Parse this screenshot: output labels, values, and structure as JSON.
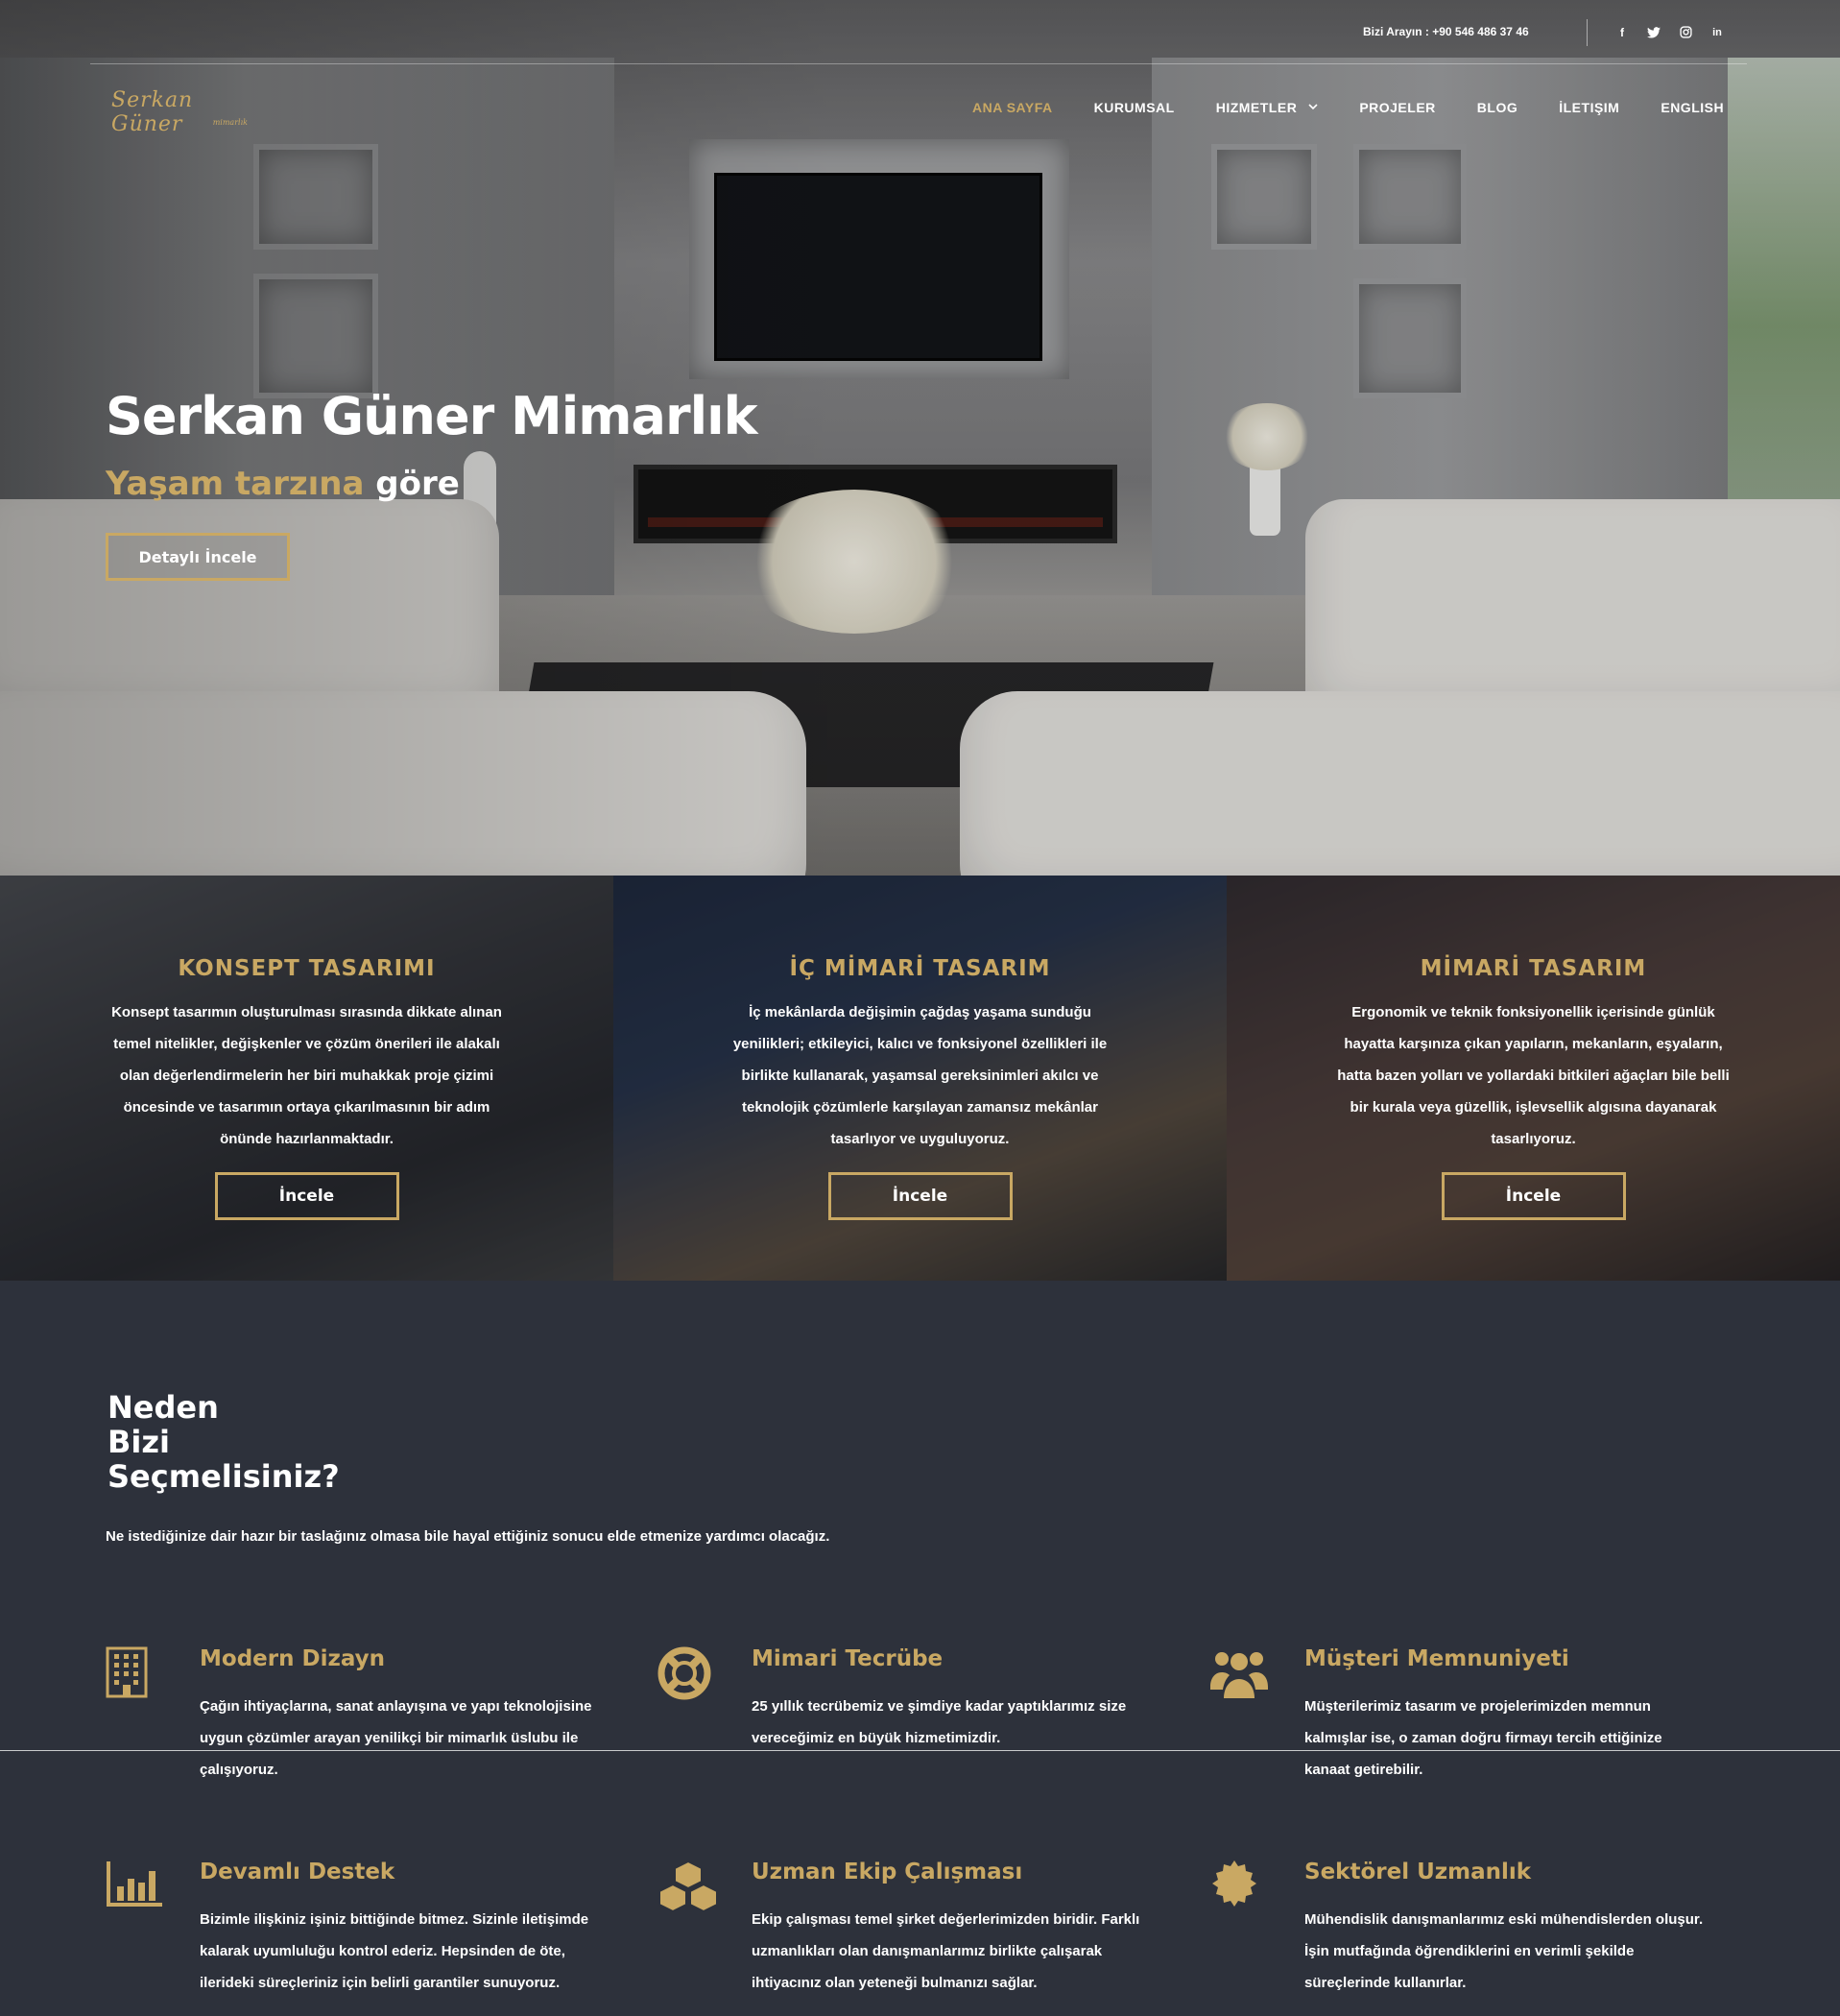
{
  "topbar": {
    "phone": "Bizi Arayın : +90 546 486 37 46",
    "social": [
      {
        "icon": "facebook-icon",
        "glyph": "f"
      },
      {
        "icon": "twitter-icon",
        "glyph": "t"
      },
      {
        "icon": "instagram-icon",
        "glyph": "◎"
      },
      {
        "icon": "linkedin-icon",
        "glyph": "in"
      }
    ]
  },
  "logo": {
    "text": "Serkan Güner",
    "sub": "mimarlık"
  },
  "nav": {
    "items": [
      "ANA SAYFA",
      "KURUMSAL",
      "HIZMETLER",
      "PROJELER",
      "BLOG",
      "İLETIŞIM",
      "ENGLISH"
    ],
    "active": "ANA SAYFA"
  },
  "hero": {
    "title": "Serkan Güner Mimarlık",
    "subtitle_gold": "Yaşam tarzına",
    "subtitle_white": " göre",
    "button": "Detaylı İncele"
  },
  "cards": [
    {
      "title": "KONSEPT TASARIMI",
      "text": "Konsept tasarımın oluşturulması sırasında dikkate alınan temel nitelikler, değişkenler ve çözüm önerileri ile alakalı olan değerlendirmelerin her biri muhakkak proje çizimi öncesinde ve tasarımın ortaya çıkarılmasının bir adım önünde hazırlanmaktadır.",
      "button": "İncele"
    },
    {
      "title": "İÇ MİMARİ TASARIM",
      "text": "İç mekânlarda değişimin çağdaş yaşama sunduğu yenilikleri; etkileyici, kalıcı ve fonksiyonel özellikleri ile birlikte kullanarak, yaşamsal gereksinimleri akılcı ve teknolojik çözümlerle karşılayan zamansız mekânlar tasarlıyor ve uyguluyoruz.",
      "button": "İncele"
    },
    {
      "title": "MİMARİ TASARIM",
      "text": "Ergonomik ve teknik fonksiyonellik içerisinde günlük hayatta karşınıza çıkan yapıların, mekanların, eşyaların, hatta bazen yolları ve yollardaki bitkileri ağaçları bile belli bir kurala veya güzellik, işlevsellik algısına dayanarak tasarlıyoruz.",
      "button": "İncele"
    }
  ],
  "why": {
    "title_lines": [
      "Neden",
      "Bizi",
      "Seçmelisiniz?"
    ],
    "lead": "Ne istediğinize dair hazır bir taslağınız olmasa bile hayal ettiğiniz sonucu elde etmenize yardımcı olacağız.",
    "features": [
      {
        "icon": "building-icon",
        "title": "Modern Dizayn",
        "text": "Çağın ihtiyaçlarına, sanat anlayışına ve yapı teknolojisine uygun çözümler arayan yenilikçi bir mimarlık üslubu ile çalışıyoruz."
      },
      {
        "icon": "life-ring-icon",
        "title": "Mimari Tecrübe",
        "text": "25 yıllık tecrübemiz ve şimdiye kadar yaptıklarımız size vereceğimiz en büyük hizmetimizdir."
      },
      {
        "icon": "users-icon",
        "title": "Müşteri Memnuniyeti",
        "text": "Müşterilerimiz tasarım ve projelerimizden memnun kalmışlar ise, o zaman doğru firmayı tercih ettiğinize kanaat getirebilir."
      },
      {
        "icon": "bar-chart-icon",
        "title": "Devamlı Destek",
        "text": "Bizimle ilişkiniz işiniz bittiğinde bitmez. Sizinle iletişimde kalarak uyumluluğu kontrol ederiz. Hepsinden de öte, ilerideki süreçleriniz için belirli garantiler sunuyoruz."
      },
      {
        "icon": "cubes-icon",
        "title": "Uzman Ekip Çalışması",
        "text": "Ekip çalışması temel şirket değerlerimizden biridir. Farklı uzmanlıkları olan danışmanlarımız birlikte çalışarak ihtiyacınız olan yeteneği bulmanızı sağlar."
      },
      {
        "icon": "certificate-icon",
        "title": "Sektörel Uzmanlık",
        "text": "Mühendislik danışmanlarımız eski mühendislerden oluşur. İşin mutfağında öğrendiklerini en verimli şekilde süreçlerinde kullanırlar."
      }
    ]
  },
  "colors": {
    "accent": "#c9a863",
    "background": "#2d313b"
  }
}
